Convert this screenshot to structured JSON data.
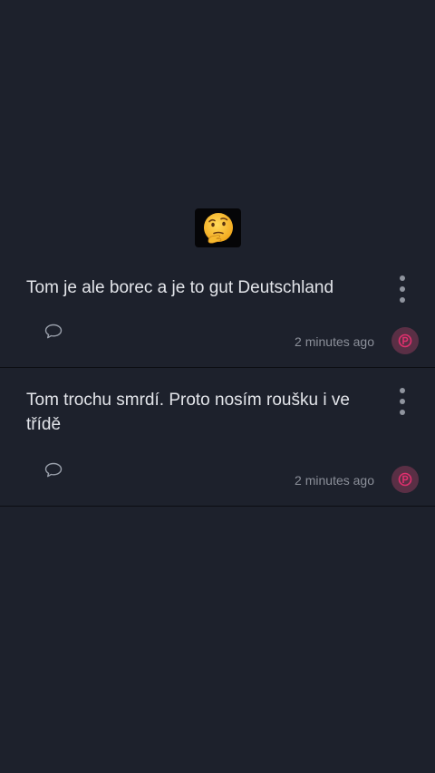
{
  "posts": [
    {
      "text": "Tom je ale borec a je to gut Deutschland",
      "time": "2 minutes ago",
      "icons": [
        "more-vertical-icon",
        "comment-icon",
        "avatar-icon"
      ]
    },
    {
      "text": "Tom trochu smrdí. Proto nosím roušku i ve třídě",
      "time": "2 minutes ago",
      "reaction": "thinking-face-emoji",
      "icons": [
        "more-vertical-icon",
        "comment-icon",
        "avatar-icon"
      ]
    }
  ],
  "colors": {
    "background": "#1d212c",
    "text": "#e3e5ea",
    "muted": "#8c909a",
    "avatar_bg": "#5a2f45",
    "avatar_fg": "#e0306e",
    "divider": "#0b0d12"
  }
}
